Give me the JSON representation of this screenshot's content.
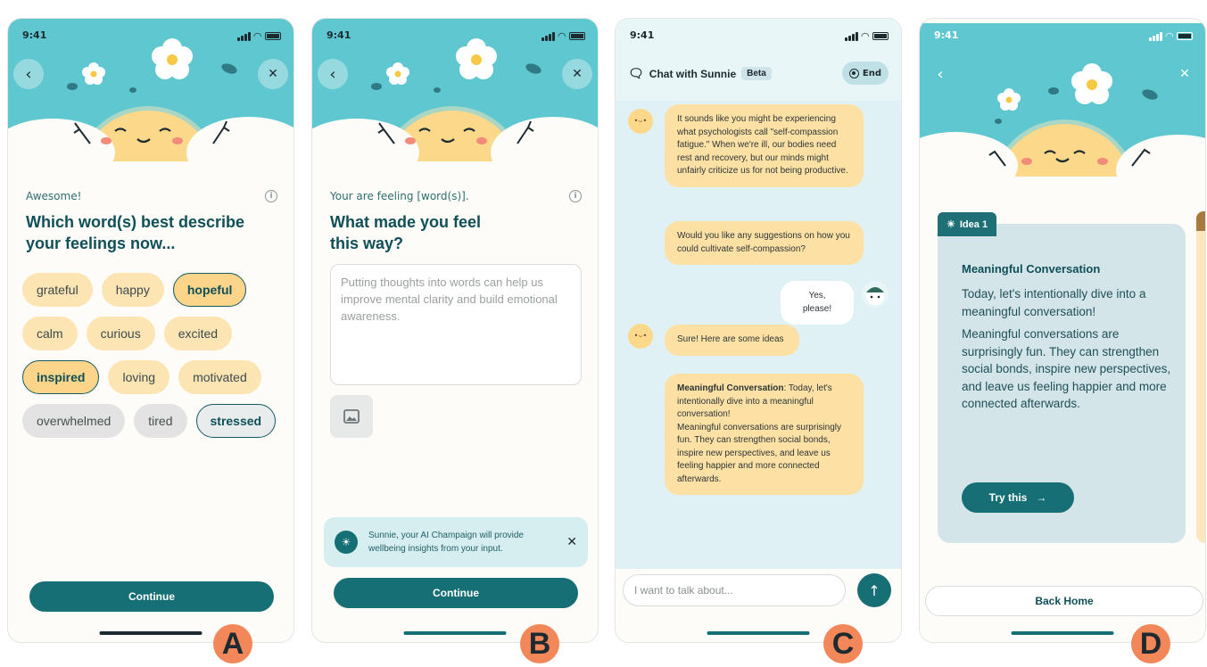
{
  "colors": {
    "teal_sky": "#5fc7cf",
    "primary": "#176f76",
    "chip_yellow": "#fde5b3",
    "badge_orange": "#f2875a"
  },
  "status": {
    "time": "9:41"
  },
  "badges": [
    "A",
    "B",
    "C",
    "D"
  ],
  "screenA": {
    "subtitle": "Awesome!",
    "heading_line1": "Which word(s) best describe",
    "heading_line2": "your feelings now...",
    "chip_rows": [
      [
        {
          "label": "grateful",
          "state": "normal"
        },
        {
          "label": "happy",
          "state": "normal"
        },
        {
          "label": "hopeful",
          "state": "selected"
        }
      ],
      [
        {
          "label": "calm",
          "state": "normal"
        },
        {
          "label": "curious",
          "state": "normal"
        },
        {
          "label": "excited",
          "state": "normal"
        }
      ],
      [
        {
          "label": "inspired",
          "state": "selected"
        },
        {
          "label": "loving",
          "state": "normal"
        },
        {
          "label": "motivated",
          "state": "normal"
        }
      ],
      [
        {
          "label": "overwhelmed",
          "state": "gray"
        },
        {
          "label": "tired",
          "state": "gray"
        },
        {
          "label": "stressed",
          "state": "selected-gray"
        }
      ]
    ],
    "continue_label": "Continue"
  },
  "screenB": {
    "subtitle": "Your are feeling [word(s)].",
    "heading_line1": "What made you feel",
    "heading_line2": "this way?",
    "textarea_placeholder": "Putting thoughts into words can help us improve mental clarity and build emotional awareness.",
    "toast_text": "Sunnie, your AI Champaign will provide wellbeing insights from your input.",
    "continue_label": "Continue"
  },
  "screenC": {
    "title": "Chat with Sunnie",
    "beta": "Beta",
    "end_label": "End",
    "msg1": "It sounds like you might be experiencing what psychologists call \"self-compassion fatigue.\" When we're ill, our bodies need rest and recovery, but our minds might unfairly criticize us for not being productive.",
    "msg2": "Would you like any suggestions on how you could cultivate self-compassion?",
    "user_msg": "Yes, please!",
    "msg3": "Sure! Here are some ideas",
    "msg4_bold": "Meaningful Conversation",
    "msg4_rest": ": Today, let's intentionally dive into a meaningful conversation!",
    "msg4_p2": "Meaningful conversations are surprisingly fun. They can strengthen social bonds, inspire new perspectives, and leave us feeling happier and more connected afterwards.",
    "input_placeholder": "I want to talk about..."
  },
  "screenD": {
    "tab_label": "Idea 1",
    "title": "Meaningful Conversation",
    "p1": "Today, let's intentionally dive into a meaningful conversation!",
    "p2": "Meaningful conversations are surprisingly fun. They can strengthen social bonds, inspire new perspectives, and leave us feeling happier and more connected afterwards.",
    "try_label": "Try this",
    "back_home": "Back Home"
  }
}
